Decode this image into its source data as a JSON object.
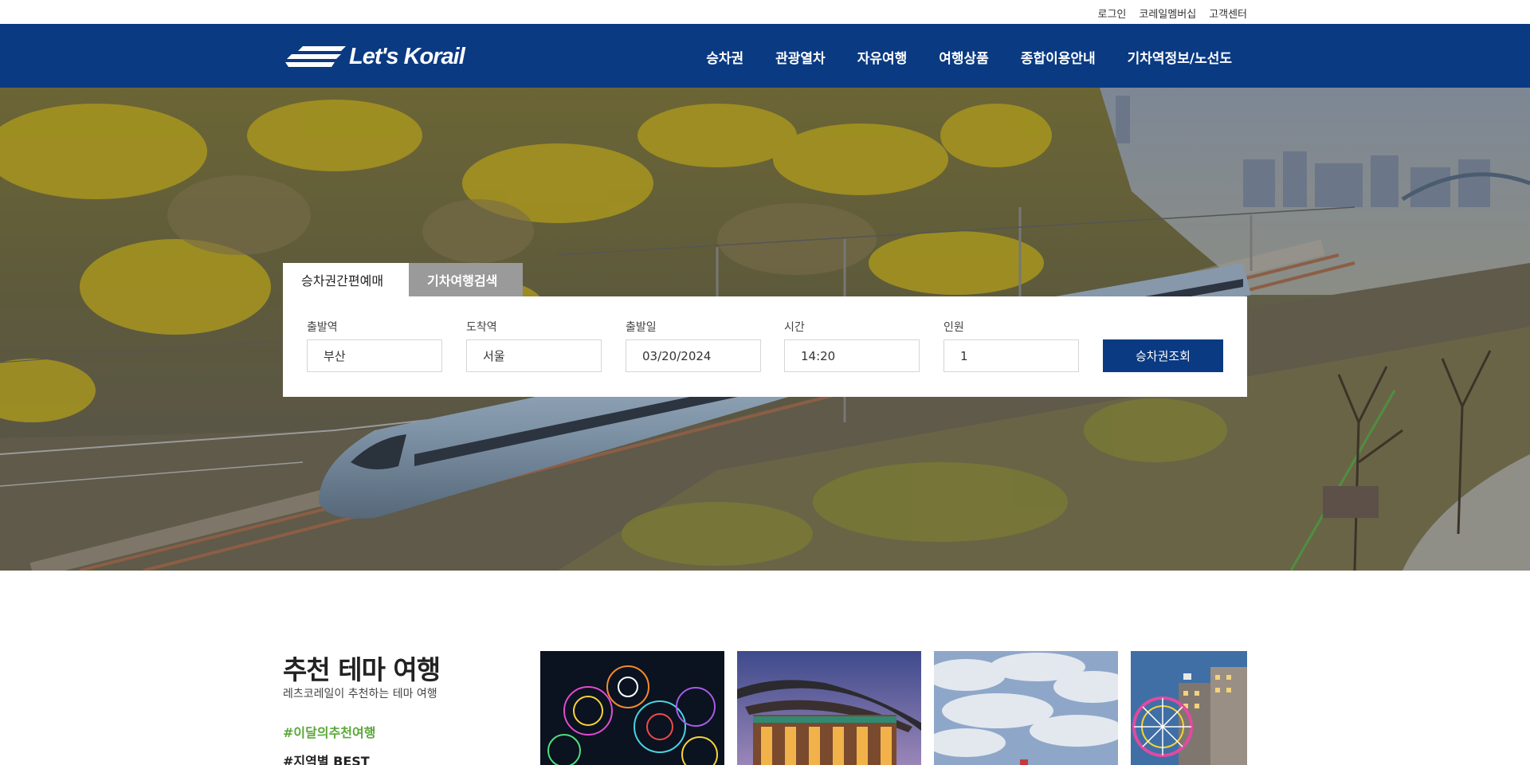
{
  "util_links": [
    "로그인",
    "코레일멤버십",
    "고객센터"
  ],
  "header": {
    "logo_text": "Let's Korail",
    "nav": [
      "승차권",
      "관광열차",
      "자유여행",
      "여행상품",
      "종합이용안내",
      "기차역정보/노선도"
    ]
  },
  "booking": {
    "tabs": [
      "승차권간편예매",
      "기차여행검색"
    ],
    "fields": [
      {
        "label": "출발역",
        "value": "부산"
      },
      {
        "label": "도착역",
        "value": "서울"
      },
      {
        "label": "출발일",
        "value": "03/20/2024"
      },
      {
        "label": "시간",
        "value": "14:20"
      },
      {
        "label": "인원",
        "value": "1"
      }
    ],
    "search_label": "승차권조회"
  },
  "recommend": {
    "title": "추천 테마 여행",
    "subtitle": "레츠코레일이 추천하는 테마 여행",
    "tags": [
      "#이달의추천여행",
      "#지역별 BEST"
    ],
    "cards": [
      "fireworks",
      "palace",
      "sky",
      "ferris-wheel"
    ]
  },
  "colors": {
    "brand": "#0a3a82",
    "tag_green": "#5aa83a",
    "tab_inactive": "#9a9a9a"
  }
}
